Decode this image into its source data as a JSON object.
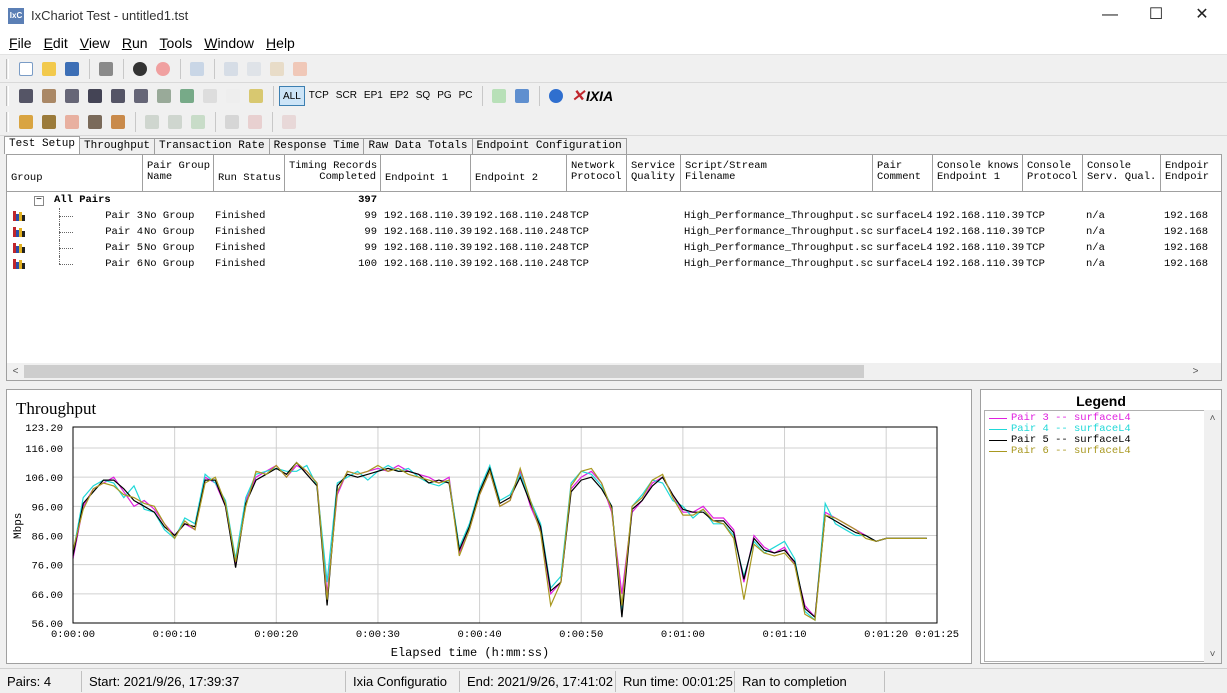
{
  "window": {
    "title": "IxChariot Test - untitled1.tst",
    "icon_text": "IxC",
    "minimize": "—",
    "maximize": "☐",
    "close": "✕"
  },
  "menu": [
    {
      "label": "File",
      "key": "F"
    },
    {
      "label": "Edit",
      "key": "E"
    },
    {
      "label": "View",
      "key": "V"
    },
    {
      "label": "Run",
      "key": "R"
    },
    {
      "label": "Tools",
      "key": "T"
    },
    {
      "label": "Window",
      "key": "W"
    },
    {
      "label": "Help",
      "key": "H"
    }
  ],
  "toolbar2": {
    "filters": [
      "ALL",
      "TCP",
      "SCR",
      "EP1",
      "EP2",
      "SQ",
      "PG",
      "PC"
    ],
    "active_filter": "ALL",
    "logo": "IXIA"
  },
  "tabs": [
    "Test Setup",
    "Throughput",
    "Transaction Rate",
    "Response Time",
    "Raw Data Totals",
    "Endpoint Configuration"
  ],
  "active_tab": "Test Setup",
  "grid": {
    "headers": {
      "group": "Group",
      "pair_group_name": "Pair Group\nName",
      "run_status": "Run Status",
      "timing_records": "Timing Records\nCompleted",
      "endpoint1": "Endpoint 1",
      "endpoint2": "Endpoint 2",
      "network_protocol": "Network\nProtocol",
      "service_quality": "Service\nQuality",
      "script": "Script/Stream\nFilename",
      "pair_comment": "Pair\nComment",
      "console_knows": "Console knows\nEndpoint 1",
      "console_protocol": "Console\nProtocol",
      "console_serv_qual": "Console\nServ. Qual.",
      "endpoint_cut": "Endpoir\nEndpoir"
    },
    "all_pairs": {
      "label": "All Pairs",
      "total": "397",
      "expand": "−"
    },
    "rows": [
      {
        "pair": "Pair 3",
        "group": "No Group",
        "status": "Finished",
        "records": "99",
        "ep1": "192.168.110.39",
        "ep2": "192.168.110.248",
        "protocol": "TCP",
        "quality": "",
        "script": "High_Performance_Throughput.scr",
        "comment": "surfaceL4",
        "console_knows": "192.168.110.39",
        "console_protocol": "TCP",
        "console_sq": "n/a",
        "ep_cut": "192.168"
      },
      {
        "pair": "Pair 4",
        "group": "No Group",
        "status": "Finished",
        "records": "99",
        "ep1": "192.168.110.39",
        "ep2": "192.168.110.248",
        "protocol": "TCP",
        "quality": "",
        "script": "High_Performance_Throughput.scr",
        "comment": "surfaceL4",
        "console_knows": "192.168.110.39",
        "console_protocol": "TCP",
        "console_sq": "n/a",
        "ep_cut": "192.168"
      },
      {
        "pair": "Pair 5",
        "group": "No Group",
        "status": "Finished",
        "records": "99",
        "ep1": "192.168.110.39",
        "ep2": "192.168.110.248",
        "protocol": "TCP",
        "quality": "",
        "script": "High_Performance_Throughput.scr",
        "comment": "surfaceL4",
        "console_knows": "192.168.110.39",
        "console_protocol": "TCP",
        "console_sq": "n/a",
        "ep_cut": "192.168"
      },
      {
        "pair": "Pair 6",
        "group": "No Group",
        "status": "Finished",
        "records": "100",
        "ep1": "192.168.110.39",
        "ep2": "192.168.110.248",
        "protocol": "TCP",
        "quality": "",
        "script": "High_Performance_Throughput.scr",
        "comment": "surfaceL4",
        "console_knows": "192.168.110.39",
        "console_protocol": "TCP",
        "console_sq": "n/a",
        "ep_cut": "192.168"
      }
    ],
    "scroll_left": "<",
    "scroll_right": ">"
  },
  "chart_data": {
    "type": "line",
    "title": "Throughput",
    "xlabel": "Elapsed time (h:mm:ss)",
    "ylabel": "Mbps",
    "ylim": [
      56,
      123.2
    ],
    "xlim": [
      0,
      85
    ],
    "yticks": [
      "56.00",
      "66.00",
      "76.00",
      "86.00",
      "96.00",
      "106.00",
      "116.00",
      "123.20"
    ],
    "ytick_values": [
      56,
      66,
      76,
      86,
      96,
      106,
      116,
      123.2
    ],
    "xticks": [
      "0:00:00",
      "0:00:10",
      "0:00:20",
      "0:00:30",
      "0:00:40",
      "0:00:50",
      "0:01:00",
      "0:01:10",
      "0:01:20",
      "0:01:25"
    ],
    "xtick_values": [
      0,
      10,
      20,
      30,
      40,
      50,
      60,
      70,
      80,
      85
    ],
    "grid": true,
    "x": [
      0,
      1,
      2,
      3,
      4,
      5,
      6,
      7,
      8,
      9,
      10,
      11,
      12,
      13,
      14,
      15,
      16,
      17,
      18,
      19,
      20,
      21,
      22,
      23,
      24,
      25,
      26,
      27,
      28,
      29,
      30,
      31,
      32,
      33,
      34,
      35,
      36,
      37,
      38,
      39,
      40,
      41,
      42,
      43,
      44,
      45,
      46,
      47,
      48,
      49,
      50,
      51,
      52,
      53,
      54,
      55,
      56,
      57,
      58,
      59,
      60,
      61,
      62,
      63,
      64,
      65,
      66,
      67,
      68,
      69,
      70,
      71,
      72,
      73,
      74,
      75,
      76,
      77,
      78,
      79,
      80,
      81,
      82,
      83,
      84
    ],
    "series": [
      {
        "name": "Pair 3 -- surfaceL4",
        "color": "#e020e0",
        "values": [
          78,
          96,
          102,
          104,
          106,
          101,
          96,
          98,
          95,
          90,
          86,
          90,
          88,
          106,
          104,
          96,
          76,
          98,
          106,
          108,
          110,
          106,
          110,
          108,
          104,
          66,
          100,
          108,
          107,
          108,
          109,
          108,
          110,
          108,
          107,
          106,
          104,
          106,
          80,
          88,
          100,
          108,
          96,
          98,
          108,
          96,
          88,
          66,
          70,
          102,
          106,
          108,
          104,
          94,
          66,
          94,
          98,
          104,
          106,
          100,
          94,
          94,
          96,
          92,
          92,
          88,
          70,
          86,
          82,
          80,
          82,
          76,
          62,
          58,
          94,
          92,
          90,
          88,
          86,
          84,
          85,
          85,
          85,
          85,
          85
        ]
      },
      {
        "name": "Pair 4 -- surfaceL4",
        "color": "#20d8d8",
        "values": [
          80,
          99,
          103,
          105,
          104,
          99,
          103,
          95,
          94,
          88,
          85,
          92,
          90,
          107,
          104,
          98,
          78,
          99,
          107,
          108,
          109,
          108,
          108,
          110,
          103,
          70,
          104,
          106,
          108,
          105,
          108,
          110,
          108,
          109,
          106,
          104,
          103,
          105,
          82,
          90,
          102,
          110,
          98,
          100,
          107,
          98,
          90,
          68,
          72,
          104,
          108,
          107,
          103,
          96,
          60,
          96,
          100,
          105,
          104,
          98,
          96,
          92,
          95,
          90,
          90,
          86,
          72,
          84,
          80,
          82,
          84,
          78,
          60,
          57,
          97,
          90,
          88,
          86,
          86,
          84,
          85,
          85,
          85,
          85,
          85
        ]
      },
      {
        "name": "Pair 5 -- surfaceL4",
        "color": "#000000",
        "values": [
          79,
          97,
          101,
          105,
          105,
          102,
          98,
          96,
          94,
          89,
          86,
          90,
          89,
          105,
          105,
          96,
          75,
          97,
          105,
          107,
          109,
          107,
          111,
          107,
          103,
          62,
          103,
          107,
          106,
          107,
          108,
          109,
          108,
          108,
          107,
          104,
          105,
          104,
          81,
          89,
          101,
          109,
          97,
          99,
          106,
          97,
          89,
          67,
          70,
          101,
          105,
          106,
          102,
          96,
          58,
          95,
          98,
          103,
          106,
          100,
          95,
          94,
          94,
          91,
          91,
          87,
          71,
          85,
          81,
          80,
          81,
          77,
          61,
          58,
          93,
          91,
          89,
          87,
          86,
          84,
          85,
          85,
          85,
          85,
          85
        ]
      },
      {
        "name": "Pair 6 -- surfaceL4",
        "color": "#a89820",
        "values": [
          81,
          95,
          102,
          104,
          103,
          100,
          99,
          97,
          96,
          90,
          85,
          91,
          88,
          104,
          106,
          97,
          77,
          96,
          108,
          107,
          110,
          106,
          111,
          108,
          104,
          64,
          101,
          108,
          107,
          108,
          110,
          108,
          109,
          107,
          106,
          105,
          104,
          105,
          79,
          88,
          100,
          108,
          96,
          98,
          109,
          98,
          87,
          62,
          70,
          103,
          108,
          109,
          104,
          95,
          62,
          96,
          99,
          105,
          107,
          99,
          93,
          93,
          95,
          91,
          90,
          85,
          64,
          83,
          80,
          79,
          80,
          76,
          59,
          57,
          93,
          92,
          90,
          88,
          85,
          84,
          85,
          85,
          85,
          85,
          85
        ]
      }
    ]
  },
  "legend": {
    "title": "Legend",
    "items": [
      {
        "label": "Pair 3 -- surfaceL4",
        "color": "#e020e0"
      },
      {
        "label": "Pair 4 -- surfaceL4",
        "color": "#20d8d8"
      },
      {
        "label": "Pair 5 -- surfaceL4",
        "color": "#000000"
      },
      {
        "label": "Pair 6 -- surfaceL4",
        "color": "#a89820"
      }
    ]
  },
  "statusbar": {
    "pairs": "Pairs: 4",
    "start": "Start: 2021/9/26, 17:39:37",
    "config": "Ixia Configuratio",
    "end": "End: 2021/9/26, 17:41:02",
    "run_time": "Run time: 00:01:25",
    "result": "Ran to completion"
  }
}
